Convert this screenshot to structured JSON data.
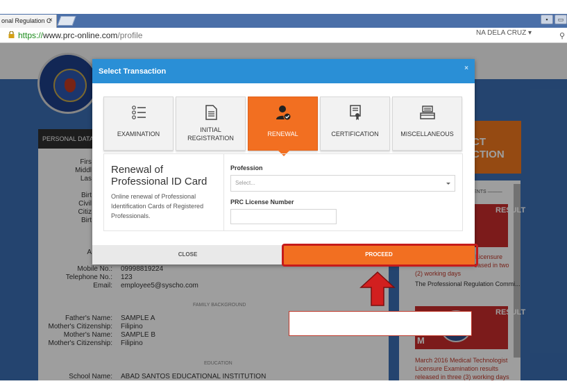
{
  "browser": {
    "tab_title": "onal Regulation C",
    "tab_close": "×",
    "url_scheme": "https://",
    "url_host": "www.prc-online.com",
    "url_path": "/profile"
  },
  "header": {
    "username": "NA DELA CRUZ ▾"
  },
  "background": {
    "personal_data_title": "PERSONAL DATA",
    "select_transaction_banner": "CT\nCTION",
    "contact_labels": [
      "Mobile No.:",
      "Telephone No.:",
      "Email:"
    ],
    "contact_values": [
      "09998819224",
      "123",
      "employee5@syscho.com"
    ],
    "family_background_title": "FAMILY BACKGROUND",
    "family_labels": [
      "Father's Name:",
      "Mother's Citizenship:",
      "Mother's Name:",
      "Mother's Citizenship:"
    ],
    "family_values": [
      "SAMPLE A",
      "Filipino",
      "SAMPLE B",
      "Filipino"
    ],
    "education_title": "EDUCATION",
    "school_label": "School Name:",
    "school_value": "ABAD SANTOS EDUCATIONAL INSTITUTION",
    "partial_labels": [
      "Firs",
      "Middl",
      "Las",
      "Birt",
      "Civil",
      "Citiz",
      "Birt",
      "A"
    ],
    "news_header": "ENTS ———",
    "news_word": "RESULT",
    "news1_lines": [
      "Licensure",
      "eased in two",
      "(2) working days",
      "The Professional Regulation Commi..."
    ],
    "news2_badge": "M",
    "news2_lines": [
      "March 2016 Medical Technologist",
      "Licensure Examination results",
      "released in three (3) working days"
    ]
  },
  "modal": {
    "title": "Select Transaction",
    "close_x": "×",
    "options": [
      {
        "label": "EXAMINATION",
        "icon": "checklist-icon"
      },
      {
        "label": "INITIAL REGISTRATION",
        "icon": "document-icon"
      },
      {
        "label": "RENEWAL",
        "icon": "user-check-icon",
        "active": true
      },
      {
        "label": "CERTIFICATION",
        "icon": "certificate-icon"
      },
      {
        "label": "MISCELLANEOUS",
        "icon": "tray-icon"
      }
    ],
    "option_labels": {
      "examination": "EXAMINATION",
      "initial_line1": "INITIAL",
      "initial_line2": "REGISTRATION",
      "renewal": "RENEWAL",
      "certification": "CERTIFICATION",
      "miscellaneous": "MISCELLANEOUS"
    },
    "description_title": "Renewal of Professional ID Card",
    "description_text": "Online renewal of Professional Identification Cards of Registered Professionals.",
    "profession_label": "Profession",
    "profession_placeholder": "Select...",
    "license_label": "PRC License Number",
    "license_value": "",
    "close_button": "CLOSE",
    "proceed_button": "PROCEED"
  },
  "colors": {
    "modal_header": "#2a8fd6",
    "accent_orange": "#f26f21",
    "annotation_red": "#c51b1b"
  }
}
